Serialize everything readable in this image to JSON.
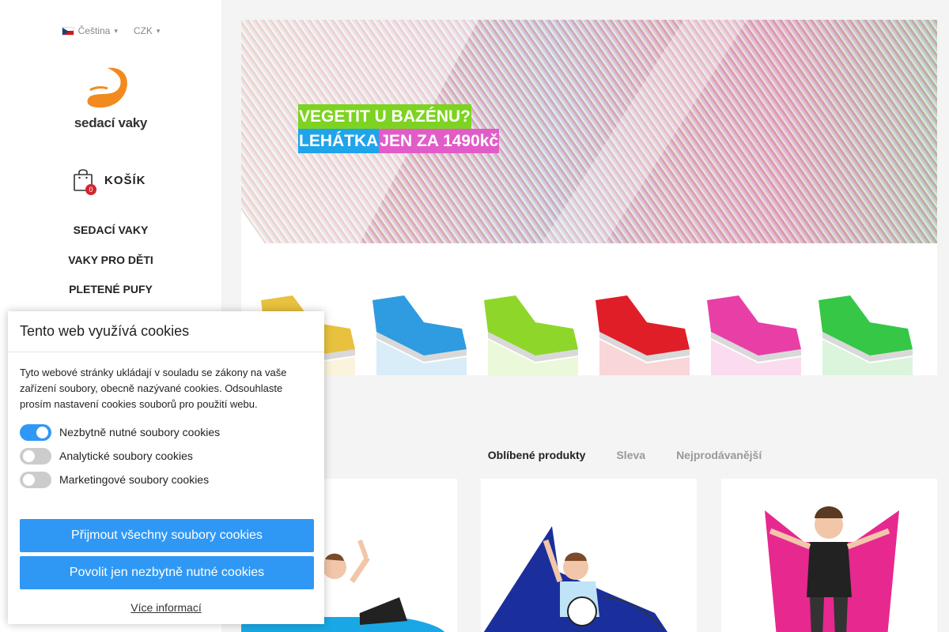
{
  "sidebar": {
    "language": "Čeština",
    "currency": "CZK",
    "logo_text": "sedací vaky",
    "cart_count": "0",
    "cart_label": "KOŠÍK",
    "nav": [
      "SEDACÍ VAKY",
      "VAKY PRO DĚTI",
      "PLETENÉ PUFY"
    ]
  },
  "banner": {
    "line1": "VEGETIT U BAZÉNU?",
    "line2a": "LEHÁTKA ",
    "line2b": "JEN ZA 1490kč",
    "lounger_colors": [
      "#e8c23e",
      "#2f9be0",
      "#8fd62b",
      "#e01e28",
      "#e83fa6",
      "#35c745"
    ]
  },
  "tabs": [
    "Oblíbené produkty",
    "Sleva",
    "Nejprodávanější"
  ],
  "cookie": {
    "title": "Tento web využívá cookies",
    "text": "Tyto webové stránky ukládají v souladu se zákony na vaše zařízení soubory, obecně nazývané cookies. Odsouhlaste prosím nastavení cookies souborů pro použití webu.",
    "toggles": [
      {
        "label": "Nezbytně nutné soubory cookies",
        "on": true
      },
      {
        "label": "Analytické soubory cookies",
        "on": false
      },
      {
        "label": "Marketingové soubory cookies",
        "on": false
      }
    ],
    "accept_all": "Přijmout všechny soubory cookies",
    "accept_necessary": "Povolit jen nezbytně nutné cookies",
    "more_info": "Více informací"
  },
  "colors": {
    "accent": "#2f98f5",
    "logo_orange": "#f28a1e",
    "badge_red": "#d0262d"
  }
}
